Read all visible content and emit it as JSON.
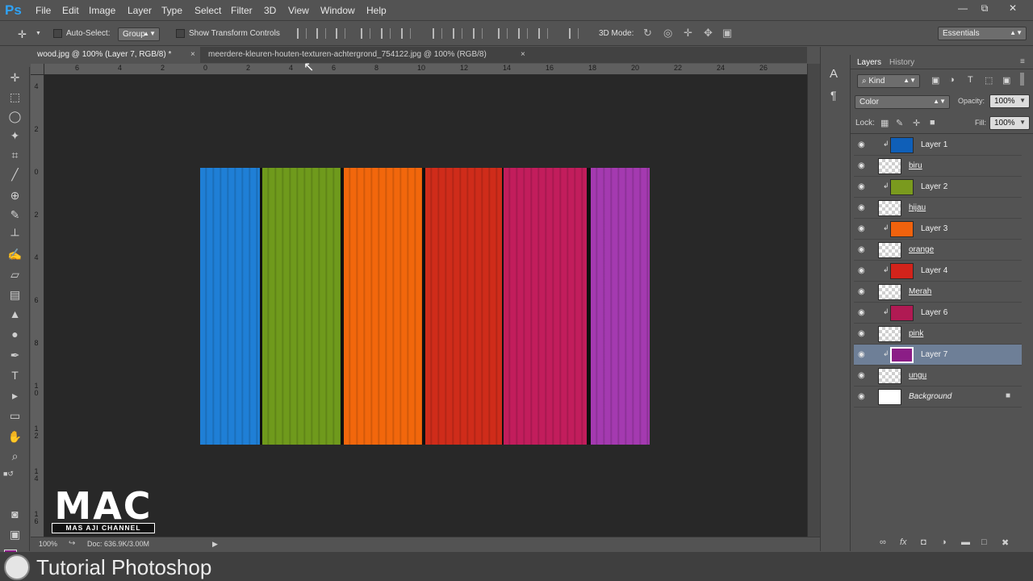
{
  "app": {
    "logo": "Ps"
  },
  "menu": [
    "File",
    "Edit",
    "Image",
    "Layer",
    "Type",
    "Select",
    "Filter",
    "3D",
    "View",
    "Window",
    "Help"
  ],
  "window_controls": {
    "minimize": "—",
    "restore": "⧉",
    "close": "✕"
  },
  "options": {
    "move_tool_icon": "move-icon",
    "auto_select_label": "Auto-Select:",
    "auto_select_value": "Group",
    "show_transform_label": "Show Transform Controls",
    "mode_3d_label": "3D Mode:",
    "workspace": "Essentials"
  },
  "tabs": [
    {
      "title": "wood.jpg @ 100% (Layer 7, RGB/8) *",
      "close": "×"
    },
    {
      "title": "meerdere-kleuren-houten-texturen-achtergrond_754122.jpg @ 100% (RGB/8)",
      "close": "×"
    }
  ],
  "ruler_h_labels": [
    "6",
    "4",
    "2",
    "0",
    "2",
    "4",
    "6",
    "8",
    "10",
    "12",
    "14",
    "16",
    "18",
    "20",
    "22",
    "24",
    "26"
  ],
  "ruler_v_labels": [
    "4",
    "2",
    "0",
    "2",
    "4",
    "6",
    "8",
    "1 0",
    "1 2",
    "1 4",
    "1 6"
  ],
  "status": {
    "zoom": "100%",
    "doc": "Doc: 636.9K/3.00M"
  },
  "planks": [
    {
      "name": "blue",
      "color": "#1f7fd6"
    },
    {
      "name": "green",
      "color": "#6f9a1c"
    },
    {
      "name": "orange",
      "color": "#f2670c"
    },
    {
      "name": "red",
      "color": "#cf2c1a"
    },
    {
      "name": "pink",
      "color": "#c21d5c"
    },
    {
      "name": "purple",
      "color": "#a43ab0"
    }
  ],
  "panel": {
    "tab_layers": "Layers",
    "tab_history": "History",
    "kind_label": "⌕ Kind",
    "blend_mode": "Color",
    "opacity_label": "Opacity:",
    "opacity_value": "100%",
    "lock_label": "Lock:",
    "fill_label": "Fill:",
    "fill_value": "100%"
  },
  "layers": [
    {
      "name": "Layer 1",
      "clip": true,
      "thumb_color": "#0f5fb8",
      "style": "plain"
    },
    {
      "name": "biru",
      "clip": false,
      "thumb_color": "",
      "style": "u"
    },
    {
      "name": "Layer 2",
      "clip": true,
      "thumb_color": "#7a9a1e",
      "style": "plain"
    },
    {
      "name": "hijau",
      "clip": false,
      "thumb_color": "",
      "style": "u"
    },
    {
      "name": "Layer 3",
      "clip": true,
      "thumb_color": "#f0620d",
      "style": "plain"
    },
    {
      "name": "orange",
      "clip": false,
      "thumb_color": "",
      "style": "u"
    },
    {
      "name": "Layer 4",
      "clip": true,
      "thumb_color": "#d2231b",
      "style": "plain"
    },
    {
      "name": "Merah",
      "clip": false,
      "thumb_color": "",
      "style": "u"
    },
    {
      "name": "Layer 6",
      "clip": true,
      "thumb_color": "#b01a53",
      "style": "plain"
    },
    {
      "name": "pink",
      "clip": false,
      "thumb_color": "",
      "style": "u"
    },
    {
      "name": "Layer 7",
      "clip": true,
      "thumb_color": "#8b1d86",
      "style": "plain",
      "selected": true
    },
    {
      "name": "ungu",
      "clip": false,
      "thumb_color": "",
      "style": "u"
    },
    {
      "name": "Background",
      "clip": false,
      "thumb_color": "#ffffff",
      "style": "i",
      "locked": true
    }
  ],
  "colors": {
    "foreground": "#8b1d86",
    "background": "#ffffff",
    "canvas": "#282828",
    "selected_layer": "#6e7f97"
  },
  "watermark": {
    "title": "MAC",
    "subtitle": "MAS AJI CHANNEL"
  },
  "caption": {
    "text": "Tutorial Photoshop"
  }
}
